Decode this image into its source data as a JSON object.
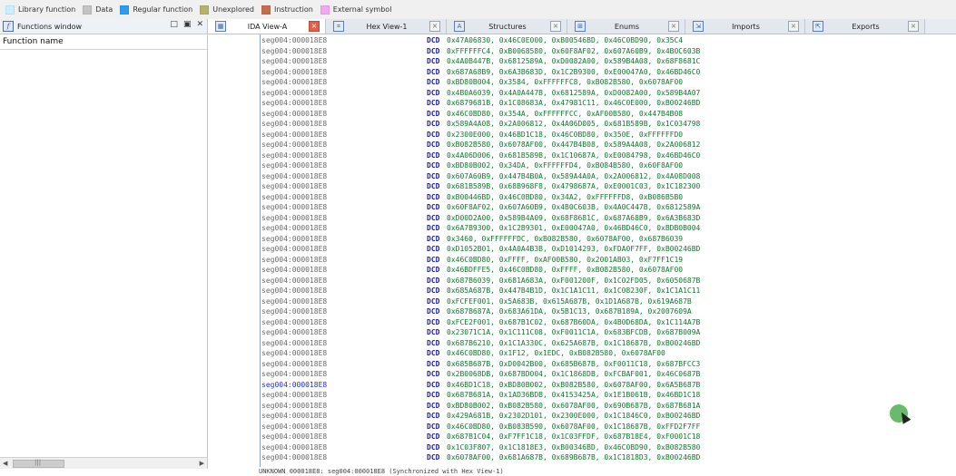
{
  "legend": [
    {
      "label": "Library function",
      "color": "#c8f0ff"
    },
    {
      "label": "Data",
      "color": "#c3c3c3"
    },
    {
      "label": "Regular function",
      "color": "#2b9bf4"
    },
    {
      "label": "Unexplored",
      "color": "#b3b36a"
    },
    {
      "label": "Instruction",
      "color": "#c86c4a"
    },
    {
      "label": "External symbol",
      "color": "#f5a7f2"
    }
  ],
  "functions_window": {
    "title": "Functions window",
    "column_header": "Function name",
    "controls": [
      "□",
      "▣",
      "✕"
    ]
  },
  "tabs": [
    {
      "label": "IDA View-A",
      "icon": "ida-view-icon",
      "active": true
    },
    {
      "label": "Hex View-1",
      "icon": "hex-view-icon",
      "active": false
    },
    {
      "label": "Structures",
      "icon": "structures-icon",
      "active": false
    },
    {
      "label": "Enums",
      "icon": "enums-icon",
      "active": false
    },
    {
      "label": "Imports",
      "icon": "imports-icon",
      "active": false
    },
    {
      "label": "Exports",
      "icon": "exports-icon",
      "active": false
    }
  ],
  "disasm": {
    "mnemonic": "DCD",
    "highlight_color": "#1f2fd8",
    "rows": [
      {
        "addr": "seg004:000018E8",
        "ops": "0x47A06830, 0x46C0E000, 0xB00546BD, 0x46C0BD90, 0x35C4"
      },
      {
        "addr": "seg004:000018E8",
        "ops": "0xFFFFFFC4, 0xB0068580, 0x60F8AF02, 0x607A60B9, 0x4B0C603B"
      },
      {
        "addr": "seg004:000018E8",
        "ops": "0x4A0B447B, 0x6812589A, 0xD0082A00, 0x589B4A08, 0x68F8681C"
      },
      {
        "addr": "seg004:000018E8",
        "ops": "0x687A68B9, 0x6A3B683D, 0x1C2B9300, 0xE00047A0, 0x46BD46C0"
      },
      {
        "addr": "seg004:000018E8",
        "ops": "0xBD80B004, 0x3584, 0xFFFFFFC8, 0xB082B580, 0x6078AF00"
      },
      {
        "addr": "seg004:000018E8",
        "ops": "0x4B0A6039, 0x4A0A447B, 0x6812589A, 0xD0082A00, 0x589B4A07"
      },
      {
        "addr": "seg004:000018E8",
        "ops": "0x6879681B, 0x1C08683A, 0x47981C11, 0x46C0E000, 0xB00246BD"
      },
      {
        "addr": "seg004:000018E8",
        "ops": "0x46C0BD80, 0x354A, 0xFFFFFFCC, 0xAF00B580, 0x447B4B08"
      },
      {
        "addr": "seg004:000018E8",
        "ops": "0x589A4A08, 0x2A006812, 0x4A06D005, 0x681B589B, 0x1C034798"
      },
      {
        "addr": "seg004:000018E8",
        "ops": "0x2300E000, 0x46BD1C18, 0x46C0BD80, 0x350E, 0xFFFFFFD0"
      },
      {
        "addr": "seg004:000018E8",
        "ops": "0xB082B580, 0x6078AF00, 0x447B4B08, 0x589A4A08, 0x2A006812"
      },
      {
        "addr": "seg004:000018E8",
        "ops": "0x4A06D006, 0x681B589B, 0x1C10687A, 0xE0084798, 0x46BD46C0"
      },
      {
        "addr": "seg004:000018E8",
        "ops": "0xBD80B002, 0x34DA, 0xFFFFFFD4, 0xB084B580, 0x60F8AF00"
      },
      {
        "addr": "seg004:000018E8",
        "ops": "0x607A60B9, 0x447B4B0A, 0x589A4A0A, 0x2A006812, 0x4A08D008"
      },
      {
        "addr": "seg004:000018E8",
        "ops": "0x681B589B, 0x68B968F8, 0x4798687A, 0xE0001C03, 0x1C182300"
      },
      {
        "addr": "seg004:000018E8",
        "ops": "0xB00446BD, 0x46C0BD80, 0x34A2, 0xFFFFFFD8, 0xB086B5B0"
      },
      {
        "addr": "seg004:000018E8",
        "ops": "0x60F8AF02, 0x607A60B9, 0x4B0C603B, 0x4A0C447B, 0x6812589A"
      },
      {
        "addr": "seg004:000018E8",
        "ops": "0xD00D2A00, 0x589B4A09, 0x68F8681C, 0x687A68B9, 0x6A3B683D"
      },
      {
        "addr": "seg004:000018E8",
        "ops": "0x6A7B9300, 0x1C2B9301, 0xE00047A0, 0x46BD46C0, 0xBDB0B004"
      },
      {
        "addr": "seg004:000018E8",
        "ops": "0x3460, 0xFFFFFFDC, 0xB082B580, 0x6078AF00, 0x687B6039"
      },
      {
        "addr": "seg004:000018E8",
        "ops": "0xD1052B01, 0x4A0A4B3B, 0xD1014293, 0xFDA0F7FF, 0xB00246BD"
      },
      {
        "addr": "seg004:000018E8",
        "ops": "0x46C0BD80, 0xFFFF, 0xAF00B580, 0x2001AB03, 0xF7FF1C19"
      },
      {
        "addr": "seg004:000018E8",
        "ops": "0x46BDFFE5, 0x46C0BD80, 0xFFFF, 0xB082B580, 0x6078AF00"
      },
      {
        "addr": "seg004:000018E8",
        "ops": "0x687B6039, 0x681A683A, 0xF001200F, 0x1C02FD05, 0x6050687B"
      },
      {
        "addr": "seg004:000018E8",
        "ops": "0x685A687B, 0x447B4B1D, 0x1C1A1C11, 0x1C08230F, 0x1C1A1C11"
      },
      {
        "addr": "seg004:000018E8",
        "ops": "0xFCFEF001, 0x5A683B, 0x615A687B, 0x1D1A687B, 0x619A687B"
      },
      {
        "addr": "seg004:000018E8",
        "ops": "0x687B687A, 0x683A61DA, 0x5B1C13, 0x687B189A, 0x2007609A"
      },
      {
        "addr": "seg004:000018E8",
        "ops": "0xFCE2F001, 0x687B1C02, 0x687B60DA, 0x4B0D68DA, 0x1C114A7B"
      },
      {
        "addr": "seg004:000018E8",
        "ops": "0x23071C1A, 0x1C111C08, 0xF0011C1A, 0x683BFCDB, 0x687B009A"
      },
      {
        "addr": "seg004:000018E8",
        "ops": "0x687B6210, 0x1C1A330C, 0x625A687B, 0x1C18687B, 0xB00246BD"
      },
      {
        "addr": "seg004:000018E8",
        "ops": "0x46C0BD80, 0x1F12, 0x1EDC, 0xB082B580, 0x6078AF00"
      },
      {
        "addr": "seg004:000018E8",
        "ops": "0x685B687B, 0xD0042B00, 0x685B687B, 0xF0011C18, 0x687BFCC3"
      },
      {
        "addr": "seg004:000018E8",
        "ops": "0x2B0068DB, 0x687BD004, 0x1C1868DB, 0xFCBAF001, 0x46C0687B"
      },
      {
        "addr": "seg004:000018E8",
        "ops": "0x46BD1C18, 0xBD80B002, 0xB082B580, 0x6078AF00, 0x6A5B687B",
        "highlight": true
      },
      {
        "addr": "seg004:000018E8",
        "ops": "0x687B681A, 0x1AD36BDB, 0x4153425A, 0x1E1B061B, 0x46BD1C18"
      },
      {
        "addr": "seg004:000018E8",
        "ops": "0xBD80B002, 0xB082B580, 0x6078AF00, 0x690B687B, 0x687B681A"
      },
      {
        "addr": "seg004:000018E8",
        "ops": "0x429A681B, 0x2302D101, 0x2300E000, 0x1C1846C0, 0xB00246BD"
      },
      {
        "addr": "seg004:000018E8",
        "ops": "0x46C0BD80, 0xB083B590, 0x6078AF00, 0x1C18687B, 0xFFD2F7FF"
      },
      {
        "addr": "seg004:000018E8",
        "ops": "0x687B1C04, 0xF7FF1C18, 0x1C03FFDF, 0x687B18E4, 0xF0001C18"
      },
      {
        "addr": "seg004:000018E8",
        "ops": "0x1C03F807, 0x1C1818E3, 0xB00346BD, 0x46C0BD90, 0xB082B580"
      },
      {
        "addr": "seg004:000018E8",
        "ops": "0x6078AF00, 0x681A687B, 0x689B687B, 0x1C1818D3, 0xB00246BD"
      }
    ]
  },
  "status_line": "UNKNOWN 000018E8: seg004:000018E8 (Synchronized with Hex View-1)"
}
